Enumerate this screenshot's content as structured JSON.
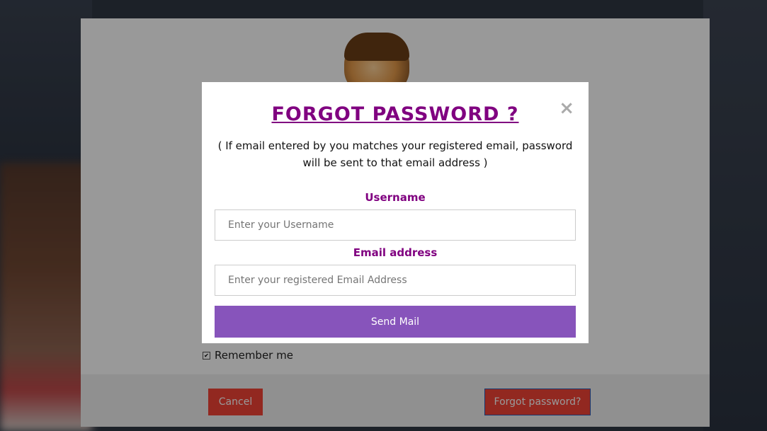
{
  "modal": {
    "title": "FORGOT PASSWORD ?",
    "close_icon": "×",
    "description": "( If email entered by you matches your registered email, password will be sent to that email address )",
    "username_label": "Username",
    "username_placeholder": "Enter your Username",
    "email_label": "Email address",
    "email_placeholder": "Enter your registered Email Address",
    "send_button": "Send Mail"
  },
  "login": {
    "remember_label": "Remember me",
    "remember_checked": true,
    "cancel_button": "Cancel",
    "forgot_button": "Forgot password?"
  },
  "colors": {
    "accent_purple": "#800080",
    "send_button": "#8754bb",
    "danger_button": "#f44336"
  }
}
